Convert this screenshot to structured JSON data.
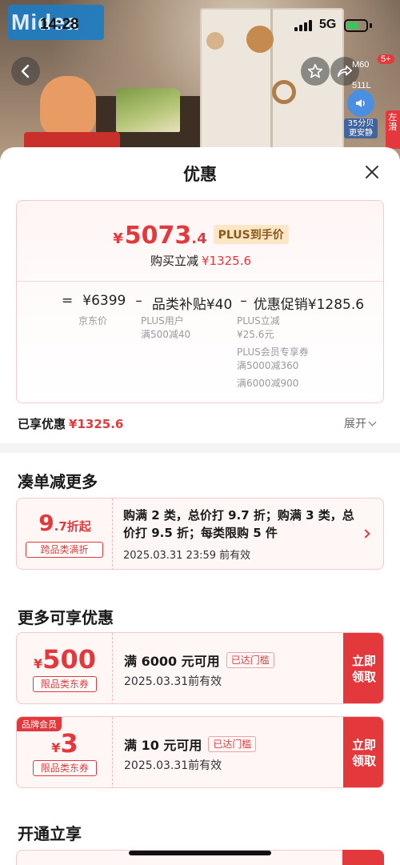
{
  "status_bar": {
    "time": "14:28",
    "network": "5G"
  },
  "background": {
    "brand_logo": "Midea",
    "model_tag_line1": "M60",
    "model_tag_line2": "511L",
    "cart_badge": "5+",
    "audio_text": "35分贝更安静",
    "side_tab": "左滑"
  },
  "sheet": {
    "title": "优惠",
    "price_card": {
      "final_currency": "¥",
      "final_int": "5073",
      "final_dec": ".4",
      "plus_tag": "PLUS到手价",
      "instant_label": "购买立减",
      "instant_amount": "¥1325.6",
      "formula": {
        "eq": "=",
        "jd_price": "¥6399",
        "minus1": "–",
        "subsidy": "品类补贴¥40",
        "minus2": "–",
        "promo": "优惠促销¥1285.6"
      },
      "jd_price_caption": "京东价",
      "subsidy_lines": [
        "PLUS用户",
        "满500减40"
      ],
      "promo_lines": [
        "PLUS立减",
        "¥25.6元",
        "PLUS会员专享券",
        "满5000减360",
        "满6000减900"
      ]
    },
    "enjoyed_label": "已享优惠",
    "enjoyed_amount": "¥1325.6",
    "expand_label": "展开",
    "section_bundle": "凑单减更多",
    "bundle": {
      "discount_big": "9",
      "discount_small": ".7折起",
      "label": "跨品类满折",
      "desc": "购满 2 类，总价打 9.7 折；购满 3 类，总价打 9.5 折；每类限购 5 件",
      "date": "2025.03.31 23:59 前有效"
    },
    "section_more": "更多可享优惠",
    "coupons": [
      {
        "currency": "¥",
        "amount": "500",
        "label": "限品类东券",
        "condition": "满 6000 元可用",
        "reached": "已达门槛",
        "date": "2025.03.31前有效",
        "btn_line1": "立即",
        "btn_line2": "领取",
        "member_badge": ""
      },
      {
        "currency": "¥",
        "amount": "3",
        "label": "限品类东券",
        "condition": "满 10 元可用",
        "reached": "已达门槛",
        "date": "2025.03.31前有效",
        "btn_line1": "立即",
        "btn_line2": "领取",
        "member_badge": "品牌会员"
      }
    ],
    "section_open": "开通立享"
  },
  "colors": {
    "accent": "#e4393c",
    "card_bg": "#fff6f6",
    "plus_tag_bg": "#fbe7c6"
  },
  "icons": {
    "back": "chevron-left-icon",
    "favorite": "star-icon",
    "share": "share-icon",
    "close": "close-icon",
    "audio": "speaker-icon"
  }
}
